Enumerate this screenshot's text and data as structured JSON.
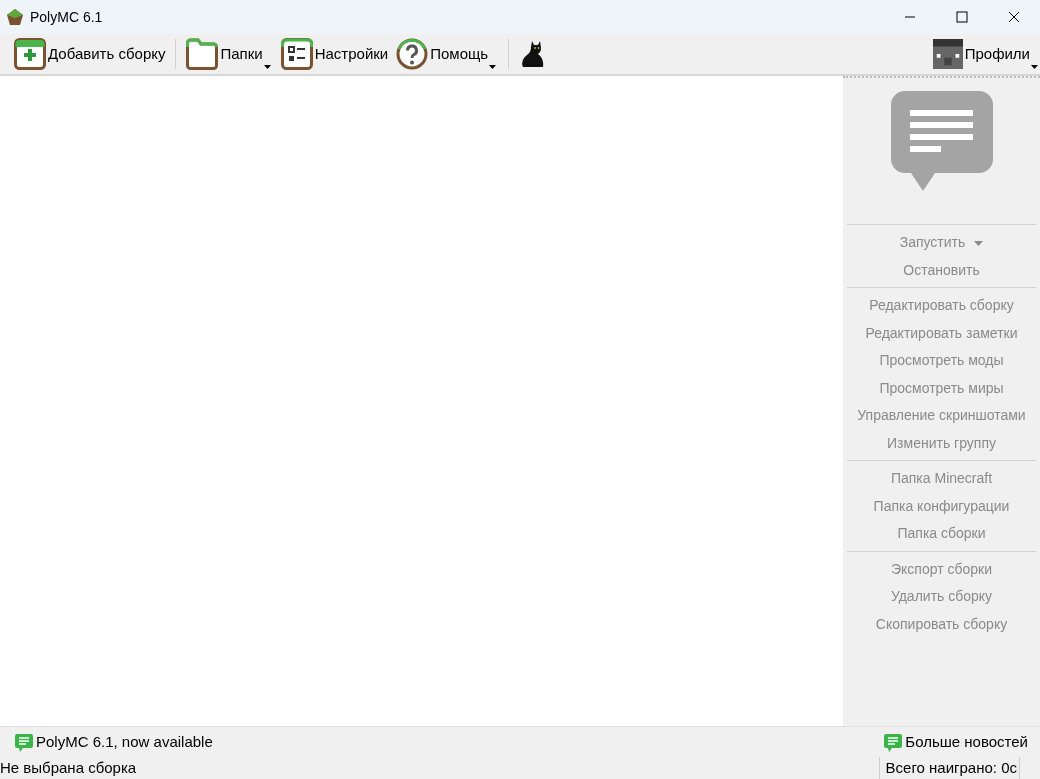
{
  "window": {
    "title": "PolyMC 6.1"
  },
  "toolbar": {
    "items": [
      {
        "label": "Добавить сборку",
        "kind": "add",
        "has_menu": false
      },
      {
        "label": "Папки",
        "kind": "folder",
        "has_menu": true
      },
      {
        "label": "Настройки",
        "kind": "settings",
        "has_menu": false
      },
      {
        "label": "Помощь",
        "kind": "help",
        "has_menu": true
      },
      {
        "kind": "cat",
        "has_menu": false
      }
    ],
    "profiles": {
      "label": "Профили",
      "has_menu": true
    }
  },
  "sidebar": {
    "groups": [
      [
        {
          "label": "Запустить",
          "kind": "dropdown",
          "disabled": true
        },
        {
          "label": "Остановить",
          "kind": "action",
          "disabled": true
        }
      ],
      [
        {
          "label": "Редактировать сборку",
          "kind": "action",
          "disabled": true
        },
        {
          "label": "Редактировать заметки",
          "kind": "action",
          "disabled": true
        },
        {
          "label": "Просмотреть моды",
          "kind": "action",
          "disabled": true
        },
        {
          "label": "Просмотреть миры",
          "kind": "action",
          "disabled": true
        },
        {
          "label": "Управление скриншотами",
          "kind": "action",
          "disabled": true
        },
        {
          "label": "Изменить группу",
          "kind": "action",
          "disabled": true
        }
      ],
      [
        {
          "label": "Папка Minecraft",
          "kind": "action",
          "disabled": true
        },
        {
          "label": "Папка конфигурации",
          "kind": "action",
          "disabled": true
        },
        {
          "label": "Папка сборки",
          "kind": "action",
          "disabled": true
        }
      ],
      [
        {
          "label": "Экспорт сборки",
          "kind": "action",
          "disabled": true
        },
        {
          "label": "Удалить сборку",
          "kind": "action",
          "disabled": true
        },
        {
          "label": "Скопировать сборку",
          "kind": "action",
          "disabled": true
        }
      ]
    ]
  },
  "news_bar": {
    "headline": "PolyMC 6.1, now available",
    "more": "Больше новостей"
  },
  "status_bar": {
    "selection": "Не выбрана сборка",
    "playtime": "Всего наиграно: 0с"
  }
}
